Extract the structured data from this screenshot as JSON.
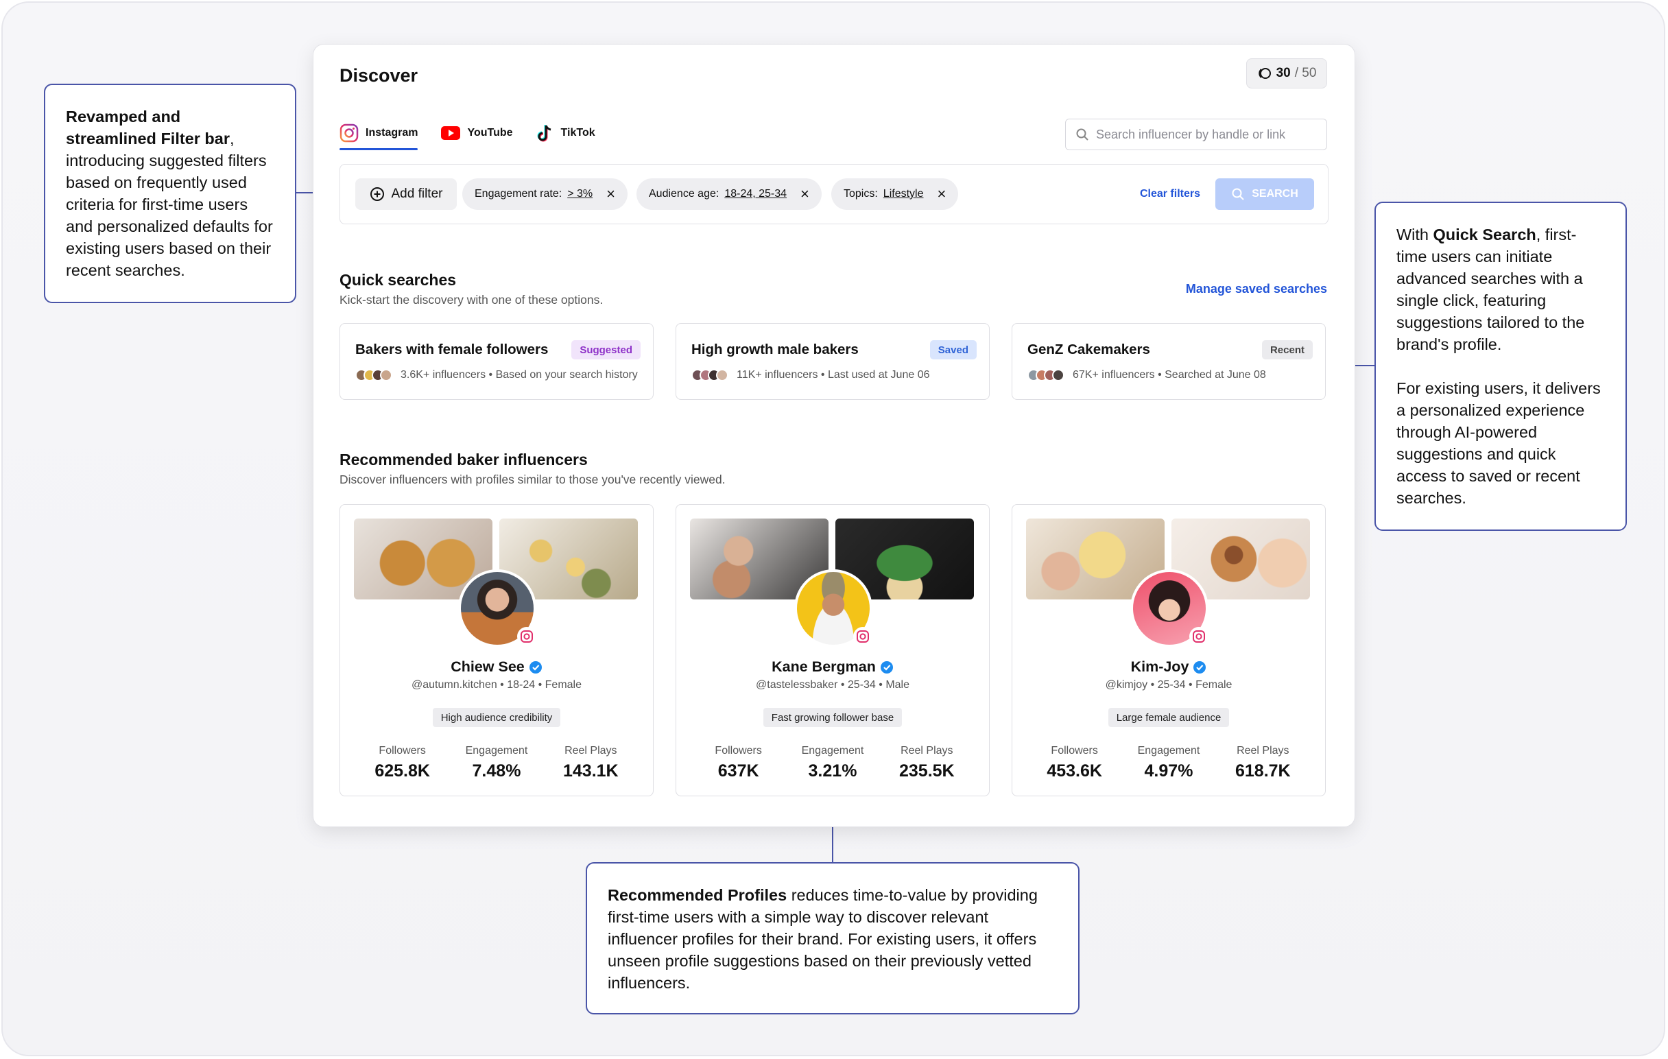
{
  "callouts": {
    "left": {
      "bold": "Revamped and streamlined Filter bar",
      "text": ", introducing suggested filters based on frequently used criteria for first-time users and personalized defaults for existing users based on their recent searches."
    },
    "right": {
      "pre": "With ",
      "bold": "Quick Search",
      "text": ", first-time users can initiate advanced searches with a single click, featuring suggestions tailored to the brand's profile.",
      "text2": "For existing users, it delivers a personalized experience through AI-powered suggestions and quick access to saved or recent searches."
    },
    "bottom": {
      "bold": "Recommended Profiles",
      "text": " reduces time-to-value by providing first-time users with a simple way to discover relevant influencer profiles for their brand. For existing users, it offers unseen profile suggestions based on their previously vetted influencers."
    }
  },
  "page": {
    "title": "Discover",
    "credits_used": "30",
    "credits_total": "/ 50"
  },
  "tabs": [
    {
      "label": "Instagram",
      "icon": "instagram-icon",
      "active": true
    },
    {
      "label": "YouTube",
      "icon": "youtube-icon",
      "active": false
    },
    {
      "label": "TikTok",
      "icon": "tiktok-icon",
      "active": false
    }
  ],
  "search": {
    "placeholder": "Search influencer by handle or link"
  },
  "filterbar": {
    "add_label": "Add filter",
    "chips": [
      {
        "key": "Engagement rate:",
        "value": "> 3%"
      },
      {
        "key": "Audience age:",
        "value": "18-24, 25-34"
      },
      {
        "key": "Topics:",
        "value": "Lifestyle"
      }
    ],
    "clear_label": "Clear filters",
    "search_label": "SEARCH"
  },
  "quick": {
    "title": "Quick searches",
    "subtitle": "Kick-start the discovery with one of these options.",
    "manage": "Manage saved searches",
    "cards": [
      {
        "title": "Bakers with female followers",
        "badge": "Suggested",
        "meta": "3.6K+ influencers • Based on your search history"
      },
      {
        "title": "High growth male bakers",
        "badge": "Saved",
        "meta": "11K+ influencers • Last used at June 06"
      },
      {
        "title": "GenZ Cakemakers",
        "badge": "Recent",
        "meta": "67K+ influencers • Searched at June 08"
      }
    ]
  },
  "recommended": {
    "title": "Recommended baker influencers",
    "subtitle": "Discover influencers with profiles similar to those you've recently viewed.",
    "labels": {
      "followers": "Followers",
      "engagement": "Engagement",
      "plays": "Reel Plays"
    },
    "profiles": [
      {
        "name": "Chiew See",
        "handle": "@autumn.kitchen • 18-24 • Female",
        "tag": "High audience credibility",
        "followers": "625.8K",
        "engagement": "7.48%",
        "plays": "143.1K"
      },
      {
        "name": "Kane Bergman",
        "handle": "@tastelessbaker • 25-34 • Male",
        "tag": "Fast growing follower base",
        "followers": "637K",
        "engagement": "3.21%",
        "plays": "235.5K"
      },
      {
        "name": "Kim-Joy",
        "handle": "@kimjoy • 25-34 • Female",
        "tag": "Large female audience",
        "followers": "453.6K",
        "engagement": "4.97%",
        "plays": "618.7K"
      }
    ]
  },
  "colors": {
    "accent": "#2355d8",
    "callout_border": "#4a55a8",
    "suggested": "#8e31c8",
    "saved": "#2f63d6"
  }
}
